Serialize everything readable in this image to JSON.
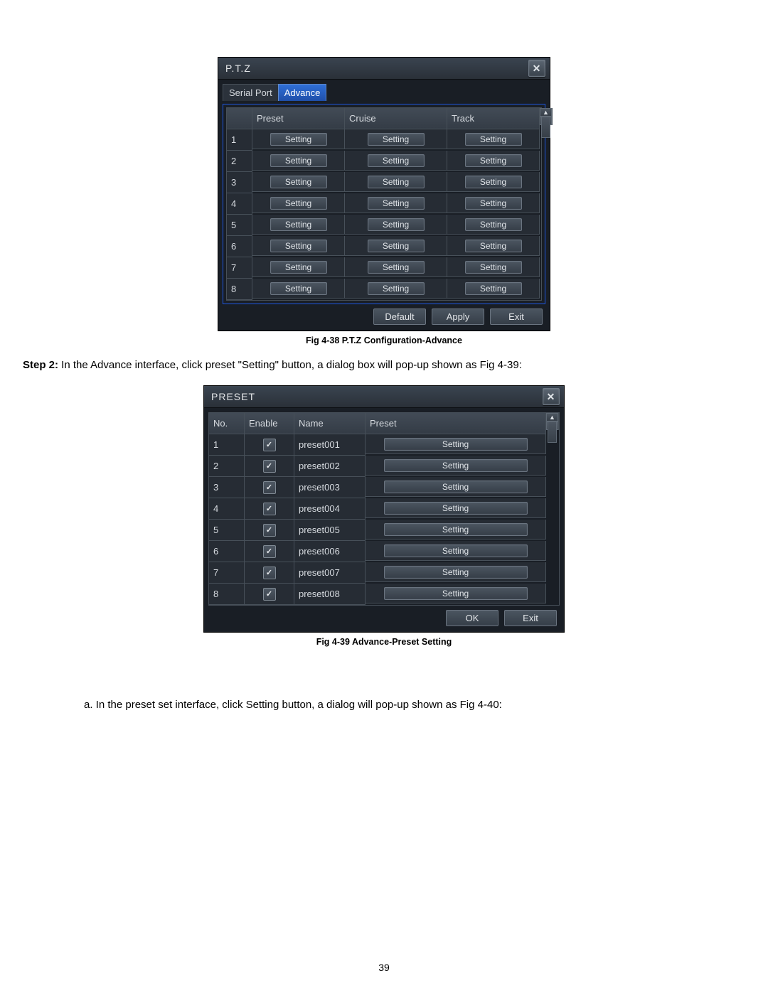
{
  "page_number": "39",
  "paragraphs": {
    "step2_label": "Step 2:",
    "step2_text": " In the Advance interface, click preset \"Setting\" button, a dialog box will pop-up shown as Fig 4-39:",
    "item_a": "a.   In the preset set interface, click Setting button, a dialog will pop-up shown as Fig 4-40:"
  },
  "fig1": {
    "caption": "Fig 4-38 P.T.Z Configuration-Advance",
    "title": "P.T.Z",
    "tabs": {
      "serial_port": "Serial Port",
      "advance": "Advance"
    },
    "headers": {
      "blank": "",
      "preset": "Preset",
      "cruise": "Cruise",
      "track": "Track"
    },
    "btn_label": "Setting",
    "rows": [
      "1",
      "2",
      "3",
      "4",
      "5",
      "6",
      "7",
      "8"
    ],
    "footer": {
      "default": "Default",
      "apply": "Apply",
      "exit": "Exit"
    }
  },
  "fig2": {
    "caption": "Fig 4-39 Advance-Preset Setting",
    "title": "PRESET",
    "headers": {
      "no": "No.",
      "enable": "Enable",
      "name": "Name",
      "preset": "Preset"
    },
    "btn_label": "Setting",
    "rows": [
      {
        "no": "1",
        "name": "preset001"
      },
      {
        "no": "2",
        "name": "preset002"
      },
      {
        "no": "3",
        "name": "preset003"
      },
      {
        "no": "4",
        "name": "preset004"
      },
      {
        "no": "5",
        "name": "preset005"
      },
      {
        "no": "6",
        "name": "preset006"
      },
      {
        "no": "7",
        "name": "preset007"
      },
      {
        "no": "8",
        "name": "preset008"
      }
    ],
    "footer": {
      "ok": "OK",
      "exit": "Exit"
    }
  }
}
